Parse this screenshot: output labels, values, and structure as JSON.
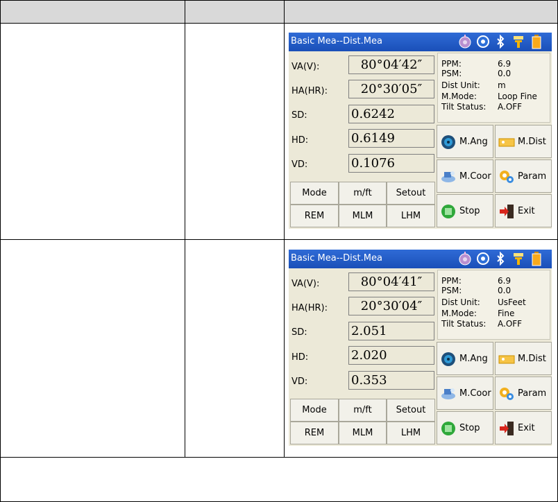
{
  "table": {
    "headers": [
      "",
      "",
      ""
    ],
    "rows": [
      {
        "col1": "",
        "col2": ""
      },
      {
        "col1": "",
        "col2": ""
      }
    ],
    "footer": ""
  },
  "screens": [
    {
      "title": "Basic Mea--Dist.Mea",
      "status_icons": [
        "compass-icon",
        "gear-icon",
        "bluetooth-icon",
        "signal-icon",
        "battery-icon"
      ],
      "va_label": "VA(V):",
      "va_value": "80°04′42″",
      "ha_label": "HA(HR):",
      "ha_value": "20°30′05″",
      "sd_label": "SD:",
      "sd_value": "0.6242",
      "hd_label": "HD:",
      "hd_value": "0.6149",
      "vd_label": "VD:",
      "vd_value": "0.1076",
      "info": {
        "ppm_label": "PPM:",
        "ppm_value": "6.9",
        "psm_label": "PSM:",
        "psm_value": "0.0",
        "unit_label": "Dist Unit:",
        "unit_value": "m",
        "mode_label": "M.Mode:",
        "mode_value": "Loop Fine",
        "tilt_label": "Tilt Status:",
        "tilt_value": "A.OFF"
      },
      "buttons": {
        "mode": "Mode",
        "mft": "m/ft",
        "setout": "Setout",
        "rem": "REM",
        "mlm": "MLM",
        "lhm": "LHM",
        "mang": "M.Ang",
        "mdist": "M.Dist",
        "mcoor": "M.Coor",
        "param": "Param",
        "stop": "Stop",
        "exit": "Exit"
      }
    },
    {
      "title": "Basic Mea--Dist.Mea",
      "status_icons": [
        "compass-icon",
        "gear-icon",
        "bluetooth-icon",
        "signal-icon",
        "battery-icon"
      ],
      "va_label": "VA(V):",
      "va_value": "80°04′41″",
      "ha_label": "HA(HR):",
      "ha_value": "20°30′04″",
      "sd_label": "SD:",
      "sd_value": "2.051",
      "hd_label": "HD:",
      "hd_value": "2.020",
      "vd_label": "VD:",
      "vd_value": "0.353",
      "info": {
        "ppm_label": "PPM:",
        "ppm_value": "6.9",
        "psm_label": "PSM:",
        "psm_value": "0.0",
        "unit_label": "Dist Unit:",
        "unit_value": "UsFeet",
        "mode_label": "M.Mode:",
        "mode_value": "Fine",
        "tilt_label": "Tilt Status:",
        "tilt_value": "A.OFF"
      },
      "buttons": {
        "mode": "Mode",
        "mft": "m/ft",
        "setout": "Setout",
        "rem": "REM",
        "mlm": "MLM",
        "lhm": "LHM",
        "mang": "M.Ang",
        "mdist": "M.Dist",
        "mcoor": "M.Coor",
        "param": "Param",
        "stop": "Stop",
        "exit": "Exit"
      }
    }
  ]
}
